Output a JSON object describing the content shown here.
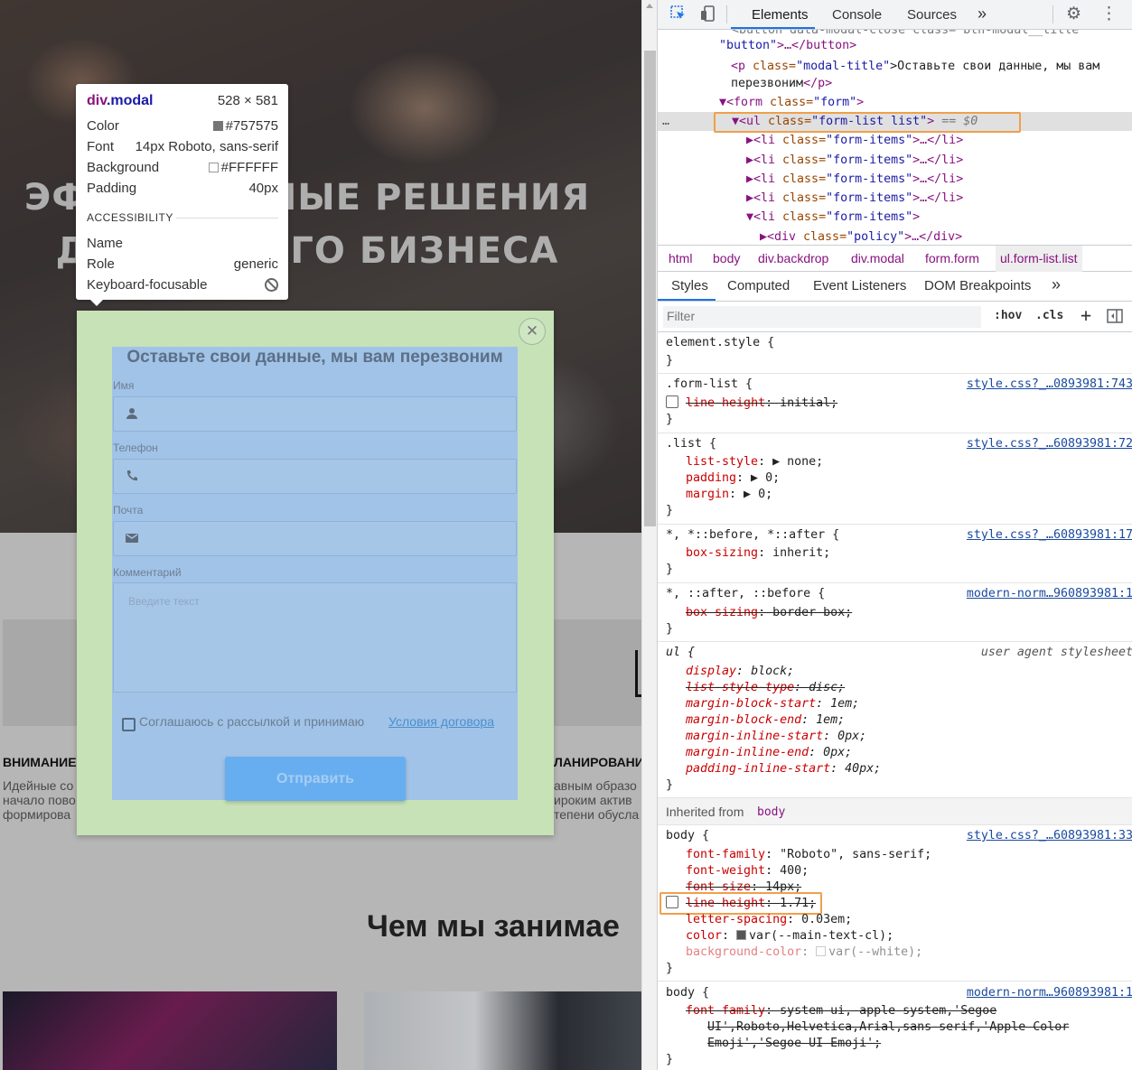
{
  "site": {
    "hero_line1": "ЭФФЕКТИВНЫЕ РЕШЕНИЯ",
    "hero_line2": "ДЛЯ ВАШЕГО БИЗНЕСА",
    "feature1_title": "ВНИМАНИЕ",
    "feature1_text": [
      "Идейные со",
      "начало пово",
      "формирова"
    ],
    "feature2_title": "ЛАНИРОВАНИ",
    "feature2_text": [
      "авным образо",
      "ироким актив",
      "тепени обусла"
    ],
    "section_title": "Чем мы занимае"
  },
  "modal": {
    "close_symbol": "✕",
    "title": "Оставьте свои данные, мы вам перезвоним",
    "fields": [
      {
        "label": "Имя",
        "icon": "person-icon"
      },
      {
        "label": "Телефон",
        "icon": "phone-icon"
      },
      {
        "label": "Почта",
        "icon": "email-icon"
      }
    ],
    "comment_label": "Комментарий",
    "comment_placeholder": "Введите текст",
    "agree_text": "Соглашаюсь с рассылкой и принимаю",
    "agree_link": "Условия договора",
    "submit": "Отправить"
  },
  "tooltip": {
    "tag": "div",
    "cls": ".modal",
    "size": "528 × 581",
    "color_label": "Color",
    "color_value": "#757575",
    "font_label": "Font",
    "font_value": "14px Roboto, sans-serif",
    "bg_label": "Background",
    "bg_value": "#FFFFFF",
    "padding_label": "Padding",
    "padding_value": "40px",
    "accessibility": "ACCESSIBILITY",
    "name_label": "Name",
    "role_label": "Role",
    "role_value": "generic",
    "focus_label": "Keyboard-focusable"
  },
  "devtools": {
    "tabs": [
      "Elements",
      "Console",
      "Sources",
      "»"
    ],
    "dom": {
      "line0": "<button data-modal-close class=\"btn-modal__title\"",
      "line1a": "\"button\"",
      "line1b": ">…</button>",
      "p_tag": "<p",
      "p_attr": " class=",
      "p_val": "\"modal-title\"",
      "p_text": ">Оставьте свои данные, мы вам",
      "p_text2": "перезвоним",
      "p_close": "</p>",
      "form_open": "▼<form",
      "form_attr": " class=",
      "form_val": "\"form\"",
      "form_close": ">",
      "ul_open": "▼<ul",
      "ul_attr": " class=",
      "ul_val": "\"form-list list\"",
      "ul_close": ">",
      "ul_eq": " == $0",
      "ellipsis": "…",
      "li_prefix": "▶<li",
      "li_attr": " class=",
      "li_val": "\"form-items\"",
      "li_end": ">…</li>",
      "li_open_prefix": "▼<li",
      "li_open_end": ">",
      "div_prefix": "▶<div",
      "div_attr": " class=",
      "div_val": "\"policy\"",
      "div_end": ">…</div>"
    },
    "breadcrumbs": [
      "html",
      "body",
      "div.backdrop",
      "div.modal",
      "form.form",
      "ul.form-list.list"
    ],
    "subtabs": [
      "Styles",
      "Computed",
      "Event Listeners",
      "DOM Breakpoints",
      "»"
    ],
    "filter_placeholder": "Filter",
    "hov": ":hov",
    "cls": ".cls",
    "plus": "+",
    "rules": {
      "element_style": "element.style {",
      "close": "}",
      "form_list_sel": ".form-list {",
      "form_list_src": "style.css?_…0893981:743",
      "form_list_prop": "line-height",
      "form_list_val": "initial;",
      "list_sel": ".list {",
      "list_src": "style.css?_…60893981:72",
      "list_p1": "list-style",
      "list_v1": "none;",
      "list_p2": "padding",
      "list_v2": "0;",
      "list_p3": "margin",
      "list_v3": "0;",
      "star_sel": "*, *::before, *::after {",
      "star_src": "style.css?_…60893981:17",
      "star_p": "box-sizing",
      "star_v": "inherit;",
      "star2_sel": "*, ::after, ::before {",
      "star2_src": "modern-norm…960893981:1",
      "star2_p": "box-sizing",
      "star2_v": "border-box;",
      "ul_sel": "ul {",
      "ul_src": "user agent stylesheet",
      "ul_props": [
        {
          "p": "display",
          "v": "block;",
          "struck": false
        },
        {
          "p": "list-style-type",
          "v": "disc;",
          "struck": true
        },
        {
          "p": "margin-block-start",
          "v": "1em;",
          "struck": false
        },
        {
          "p": "margin-block-end",
          "v": "1em;",
          "struck": false
        },
        {
          "p": "margin-inline-start",
          "v": "0px;",
          "struck": false
        },
        {
          "p": "margin-inline-end",
          "v": "0px;",
          "struck": false
        },
        {
          "p": "padding-inline-start",
          "v": "40px;",
          "struck": false
        }
      ],
      "inherited_label": "Inherited from",
      "inherited_from": "body",
      "body_sel": "body {",
      "body_src": "style.css?_…60893981:33",
      "body_props": [
        {
          "p": "font-family",
          "v": "\"Roboto\", sans-serif;",
          "struck": false
        },
        {
          "p": "font-weight",
          "v": "400;",
          "struck": false
        },
        {
          "p": "font-size",
          "v": "14px;",
          "struck": false
        },
        {
          "p": "line-height",
          "v": "1.71;",
          "struck": true
        },
        {
          "p": "letter-spacing",
          "v": "0.03em;",
          "struck": false
        },
        {
          "p": "color",
          "v": "var(--main-text-cl);",
          "struck": false
        },
        {
          "p": "background-color",
          "v": "var(--white);",
          "struck": false
        }
      ],
      "body2_sel": "body {",
      "body2_src": "modern-norm…960893981:1",
      "body2_p": "font-family",
      "body2_v1": "system-ui,-apple-system,'Segoe",
      "body2_v2": "UI',Roboto,Helvetica,Arial,sans-serif,'Apple Color",
      "body2_v3": "Emoji','Segoe UI Emoji';"
    }
  },
  "colors": {
    "modal_bg": "#c7e2b7",
    "content_bg": "#a1c3e7",
    "highlight": "#f0a04a",
    "accent": "#1a73e8"
  }
}
